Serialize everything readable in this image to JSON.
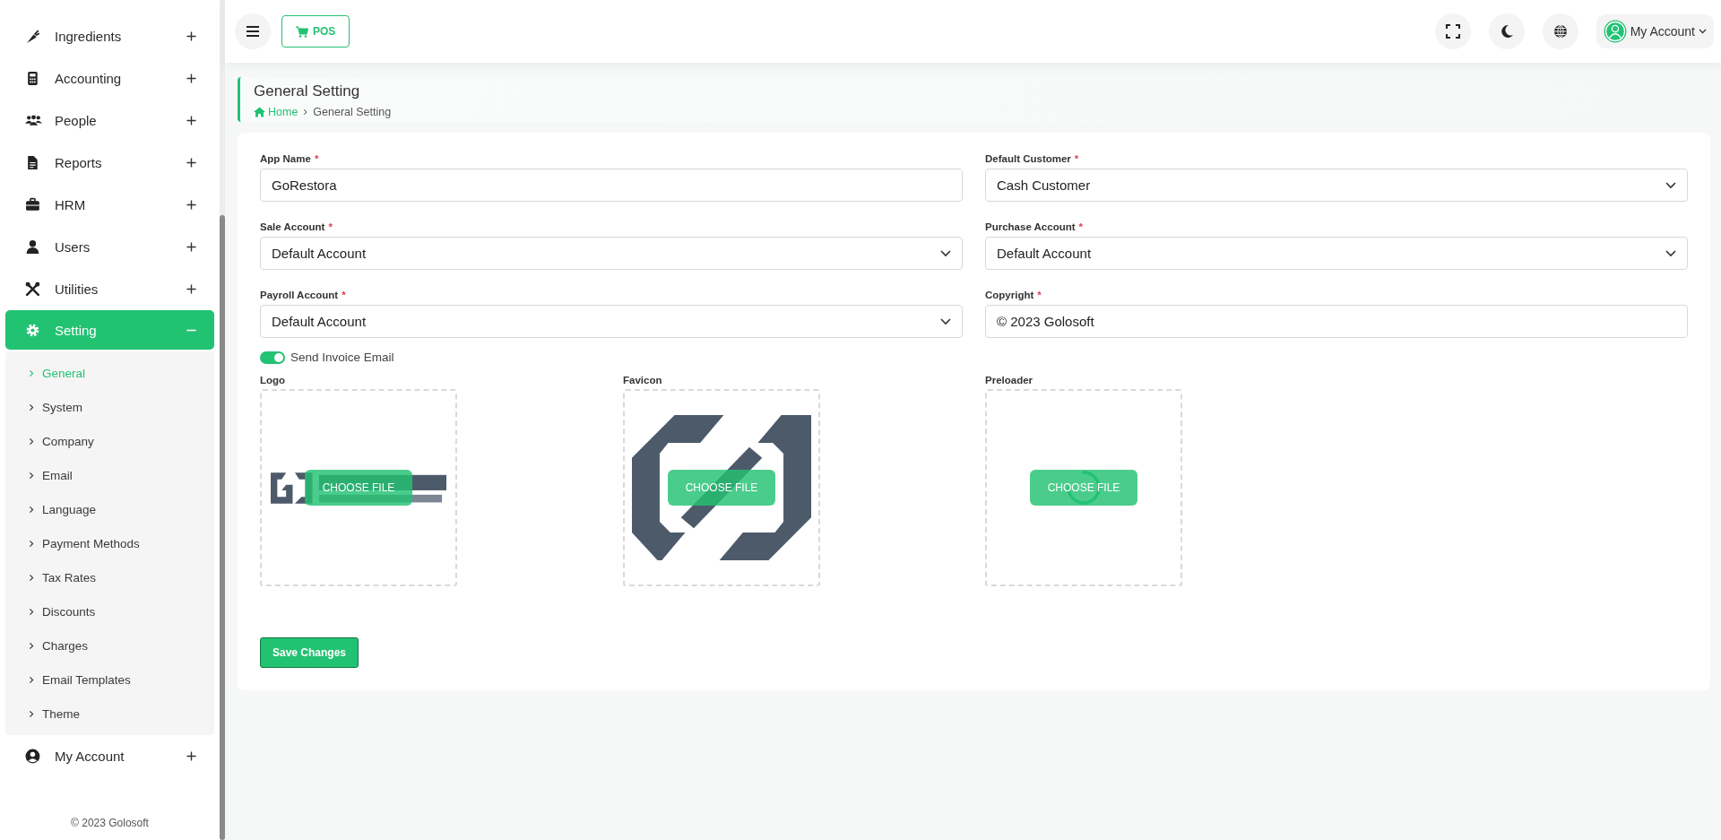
{
  "sidebar": {
    "items": [
      {
        "label": "Ingredients",
        "selected": false,
        "expanded": false
      },
      {
        "label": "Accounting",
        "selected": false,
        "expanded": false
      },
      {
        "label": "People",
        "selected": false,
        "expanded": false
      },
      {
        "label": "Reports",
        "selected": false,
        "expanded": false
      },
      {
        "label": "HRM",
        "selected": false,
        "expanded": false
      },
      {
        "label": "Users",
        "selected": false,
        "expanded": false
      },
      {
        "label": "Utilities",
        "selected": false,
        "expanded": false
      },
      {
        "label": "Setting",
        "selected": true,
        "expanded": true,
        "children": [
          {
            "label": "General",
            "selected": true
          },
          {
            "label": "System",
            "selected": false
          },
          {
            "label": "Company",
            "selected": false
          },
          {
            "label": "Email",
            "selected": false
          },
          {
            "label": "Language",
            "selected": false
          },
          {
            "label": "Payment Methods",
            "selected": false
          },
          {
            "label": "Tax Rates",
            "selected": false
          },
          {
            "label": "Discounts",
            "selected": false
          },
          {
            "label": "Charges",
            "selected": false
          },
          {
            "label": "Email Templates",
            "selected": false
          },
          {
            "label": "Theme",
            "selected": false
          }
        ]
      },
      {
        "label": "My Account",
        "selected": false,
        "expanded": false
      }
    ],
    "footer": "© 2023 Golosoft"
  },
  "header": {
    "pos_button": "POS",
    "account": "My Account"
  },
  "page": {
    "title": "General Setting",
    "breadcrumb": [
      {
        "label": "Home",
        "kind": "link"
      },
      {
        "label": "General Setting",
        "kind": "current"
      }
    ]
  },
  "form": {
    "fields": [
      {
        "label": "App Name",
        "required_mark": "*",
        "kind": "text",
        "value": "GoRestora"
      },
      {
        "label": "Default Customer",
        "required_mark": "*",
        "kind": "select",
        "value": "Cash Customer"
      },
      {
        "label": "Sale Account",
        "required_mark": "*",
        "kind": "select",
        "value": "Default Account"
      },
      {
        "label": "Purchase Account",
        "required_mark": "*",
        "kind": "select",
        "value": "Default Account"
      },
      {
        "label": "Payroll Account",
        "required_mark": "*",
        "kind": "select",
        "value": "Default Account"
      },
      {
        "label": "Copyright",
        "required_mark": "*",
        "kind": "text",
        "value": "© 2023 Golosoft"
      }
    ],
    "toggle": {
      "label": "Send Invoice Email",
      "on": true
    },
    "uploads": [
      {
        "label": "Logo",
        "kind": "logo",
        "button": "CHOOSE FILE"
      },
      {
        "label": "Favicon",
        "kind": "favicon",
        "button": "CHOOSE FILE"
      },
      {
        "label": "Preloader",
        "kind": "spinner",
        "button": "CHOOSE FILE"
      }
    ],
    "save_button": "Save Changes"
  }
}
